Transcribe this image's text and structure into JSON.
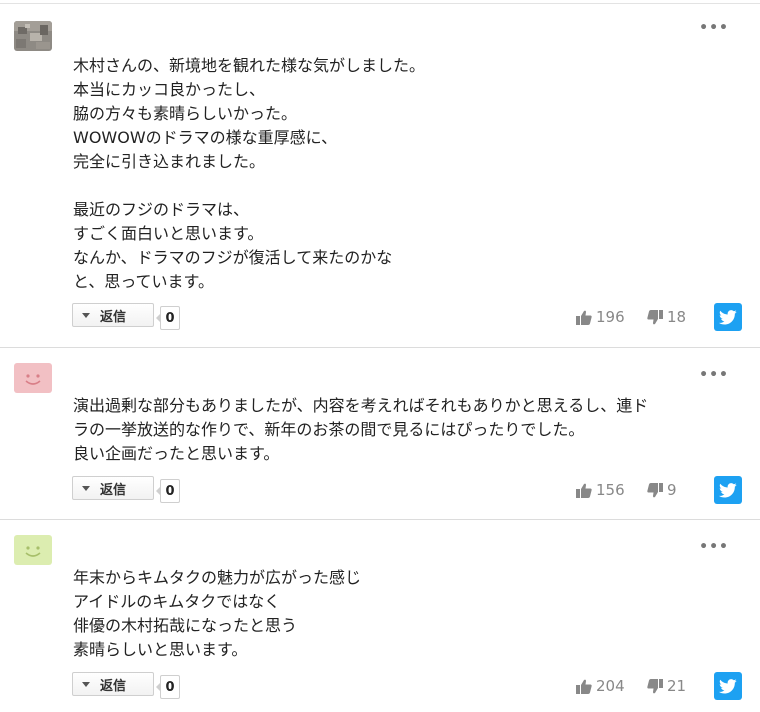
{
  "labels": {
    "reply": "返信",
    "more": "•••"
  },
  "icons": {
    "more": "ellipsis-icon",
    "reply_caret": "caret-down-icon",
    "like": "thumbs-up-icon",
    "dislike": "thumbs-down-icon",
    "share": "twitter-icon"
  },
  "colors": {
    "twitter": "#1da1f2",
    "avatar_pink": "#f2c0c4",
    "avatar_green": "#dcedb0"
  },
  "comments": [
    {
      "lines": [
        "木村さんの、新境地を観れた様な気がしました。",
        "本当にカッコ良かったし、",
        "脇の方々も素晴らしいかった。",
        "WOWOWのドラマの様な重厚感に、",
        "完全に引き込まれました。",
        "",
        "最近のフジのドラマは、",
        "すごく面白いと思います。",
        "なんか、ドラマのフジが復活して来たのかな",
        "と、思っています。"
      ],
      "reply_count": "0",
      "likes": "196",
      "dislikes": "18"
    },
    {
      "lines": [
        "演出過剰な部分もありましたが、内容を考えればそれもありかと思えるし、連ド",
        "ラの一挙放送的な作りで、新年のお茶の間で見るにはぴったりでした。",
        "良い企画だったと思います。"
      ],
      "reply_count": "0",
      "likes": "156",
      "dislikes": "9"
    },
    {
      "lines": [
        "年末からキムタクの魅力が広がった感じ",
        "アイドルのキムタクではなく",
        "俳優の木村拓哉になったと思う",
        "素晴らしいと思います。"
      ],
      "reply_count": "0",
      "likes": "204",
      "dislikes": "21"
    }
  ]
}
